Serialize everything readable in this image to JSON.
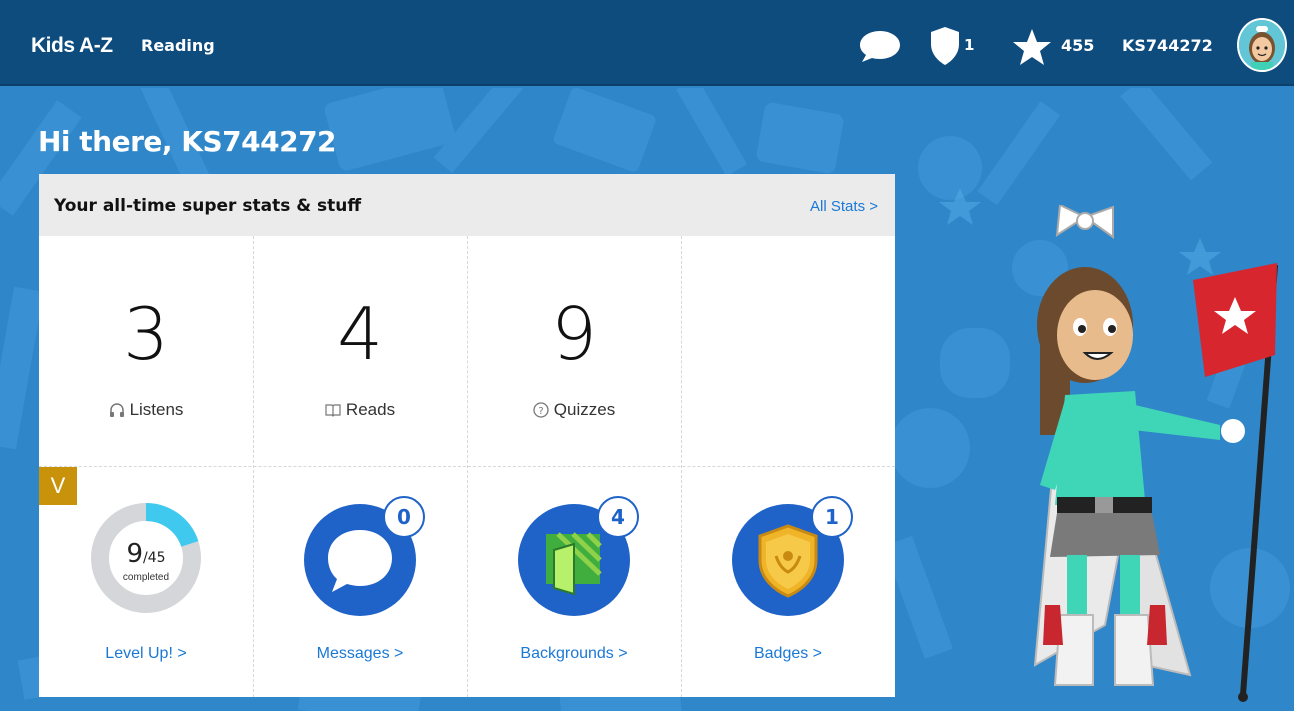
{
  "header": {
    "brand": "Kids A-Z",
    "section": "Reading",
    "shield_count": "1",
    "star_count": "455",
    "username": "KS744272",
    "icons": [
      "chat-icon",
      "shield-icon",
      "star-icon",
      "avatar"
    ]
  },
  "greeting": "Hi there, KS744272",
  "stats_card": {
    "title": "Your all-time super stats & stuff",
    "all_stats_link": "All Stats >",
    "stats": [
      {
        "value": "3",
        "label": "Listens",
        "icon": "headphones-icon"
      },
      {
        "value": "4",
        "label": "Reads",
        "icon": "book-icon"
      },
      {
        "value": "9",
        "label": "Quizzes",
        "icon": "question-icon"
      }
    ],
    "level": {
      "tag": "V",
      "completed": "9",
      "total": "/45",
      "completed_label": "completed",
      "progress_fraction": 0.2,
      "link": "Level Up! >"
    },
    "tiles": [
      {
        "count": "0",
        "link": "Messages >",
        "icon": "messages-icon"
      },
      {
        "count": "4",
        "link": "Backgrounds >",
        "icon": "backgrounds-icon"
      },
      {
        "count": "1",
        "link": "Badges >",
        "icon": "badges-icon"
      }
    ]
  },
  "colors": {
    "topbar": "#0f4c7e",
    "background": "#2f86c9",
    "link": "#1a78d6",
    "tile_circle": "#1f63c8",
    "level_tag": "#c9920b",
    "ring_progress": "#3fc9ef"
  }
}
